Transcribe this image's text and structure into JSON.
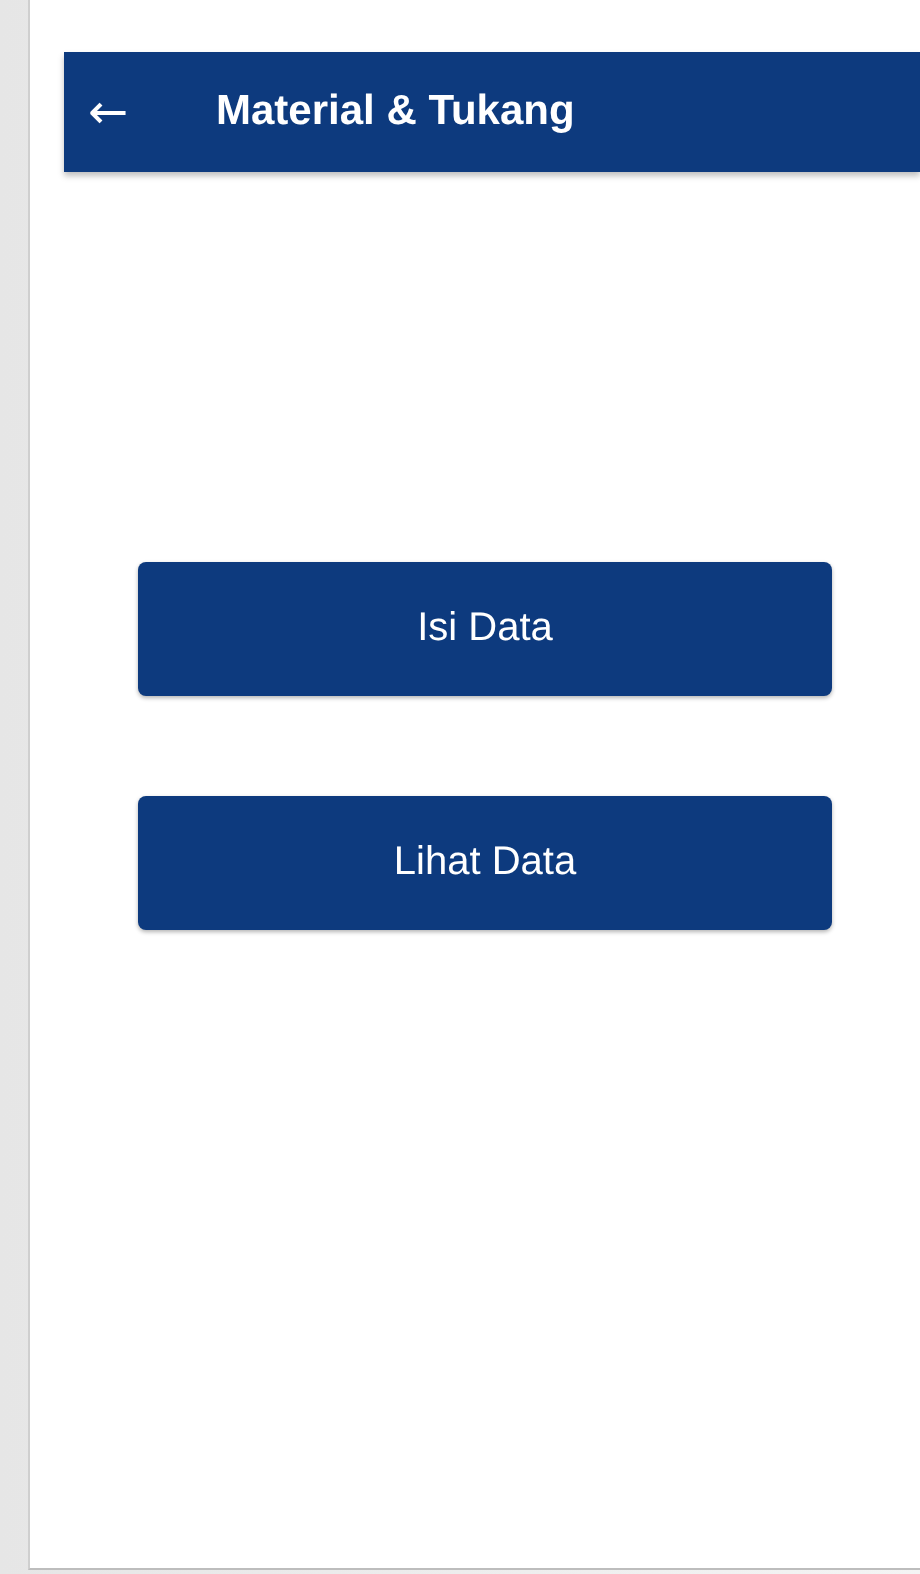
{
  "app_bar": {
    "title": "Material & Tukang",
    "back_icon": "←"
  },
  "buttons": [
    {
      "label": "Isi Data"
    },
    {
      "label": "Lihat Data"
    }
  ]
}
